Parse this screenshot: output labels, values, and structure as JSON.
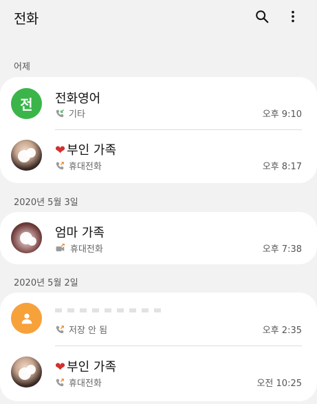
{
  "header": {
    "title": "전화",
    "icons": [
      "search-icon",
      "more-vertical-icon"
    ]
  },
  "sections": [
    {
      "label": "어제"
    },
    {
      "label": "2020년 5월 3일"
    },
    {
      "label": "2020년 5월 2일"
    }
  ],
  "calls": [
    {
      "name": "전화영어",
      "avatar_letter": "전",
      "type": "기타",
      "time": "오후 9:10",
      "call_icon": "incoming-call-icon"
    },
    {
      "name_prefix": "❤",
      "name": "부인 가족",
      "type": "휴대전화",
      "time": "오후 8:17",
      "call_icon": "outgoing-call-icon"
    },
    {
      "name": "엄마 가족",
      "type": "휴대전화",
      "time": "오후 7:38",
      "call_icon": "outgoing-video-call-icon"
    },
    {
      "name": "",
      "type": "저장 안 됨",
      "time": "오후 2:35",
      "call_icon": "outgoing-call-icon"
    },
    {
      "name_prefix": "❤",
      "name": "부인 가족",
      "type": "휴대전화",
      "time": "오전 10:25",
      "call_icon": "outgoing-call-icon"
    }
  ],
  "colors": {
    "background": "#f2f2f2",
    "card": "#ffffff",
    "accent_green": "#3bb54a",
    "default_avatar": "#f7a13a",
    "incoming_green": "#49b650",
    "outgoing_orange": "#f28b2c"
  }
}
